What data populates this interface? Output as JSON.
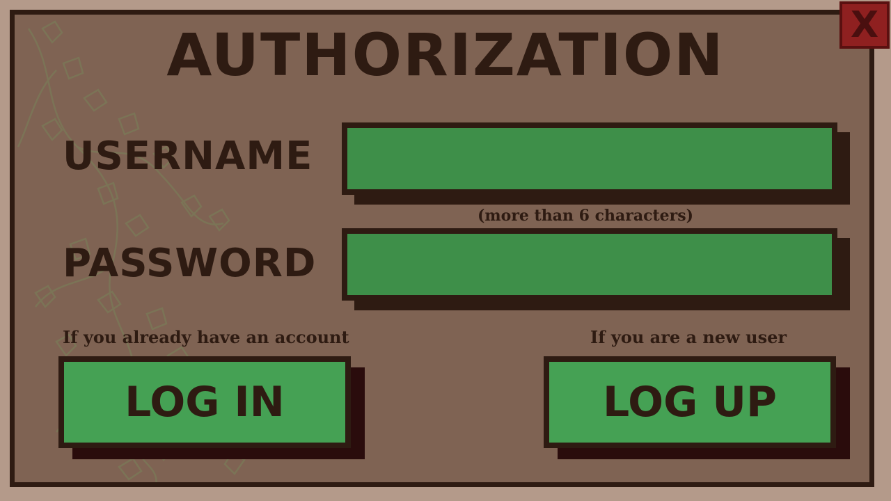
{
  "title": "AUTHORIZATION",
  "close": {
    "label": "X"
  },
  "username": {
    "label": "USERNAME",
    "value": "",
    "placeholder": "",
    "hint": "(more than 6 characters)"
  },
  "password": {
    "label": "PASSWORD",
    "value": "",
    "placeholder": ""
  },
  "login": {
    "caption": "If you already have an account",
    "label": "LOG IN"
  },
  "logup": {
    "caption": "If you are a new user",
    "label": "LOG UP"
  },
  "colors": {
    "background": "#b49a8a",
    "panel": "#7f6353",
    "border": "#2e1b12",
    "field": "#3e8f49",
    "button": "#45a154",
    "close": "#8f2020"
  },
  "icons": {
    "close": "close-icon",
    "decoration": "vine-decoration"
  }
}
